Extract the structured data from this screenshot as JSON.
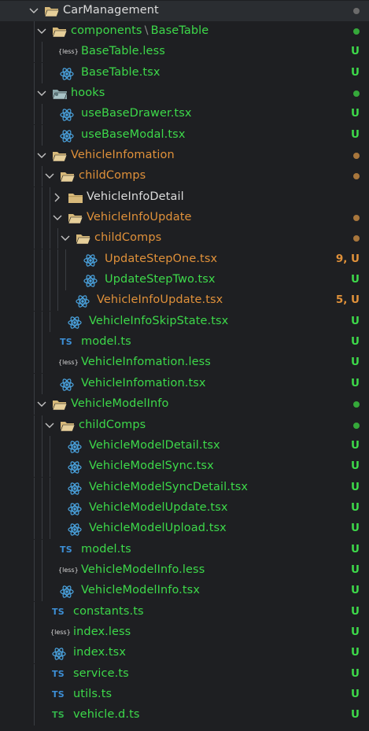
{
  "colors": {
    "green": "#3dd94a",
    "orange": "#e0913a",
    "white": "#dcdcdc",
    "dotGreen": "#35a83a",
    "dotOrange": "#a8763c",
    "react": "#4aa3df"
  },
  "rows": [
    {
      "id": "car-management",
      "label": "CarManagement",
      "depth": 0,
      "kind": "folder",
      "open": true,
      "color": "white",
      "badge": "dot",
      "badgeColor": "#6b6b6b",
      "selected": true
    },
    {
      "id": "components-basetable",
      "label": "components",
      "label2": "BaseTable",
      "depth": 1,
      "kind": "folder",
      "open": true,
      "color": "green",
      "badge": "dot",
      "badgeColor": "green"
    },
    {
      "id": "basetable-less",
      "label": "BaseTable.less",
      "depth": 2,
      "kind": "less",
      "color": "green",
      "badge": "U"
    },
    {
      "id": "basetable-tsx",
      "label": "BaseTable.tsx",
      "depth": 2,
      "kind": "react",
      "color": "green",
      "badge": "U"
    },
    {
      "id": "hooks",
      "label": "hooks",
      "depth": 1,
      "kind": "folder-special",
      "open": true,
      "color": "green",
      "badge": "dot",
      "badgeColor": "green"
    },
    {
      "id": "use-base-drawer",
      "label": "useBaseDrawer.tsx",
      "depth": 2,
      "kind": "react",
      "color": "green",
      "badge": "U"
    },
    {
      "id": "use-base-modal",
      "label": "useBaseModal.tsx",
      "depth": 2,
      "kind": "react",
      "color": "green",
      "badge": "U"
    },
    {
      "id": "vehicle-infomation",
      "label": "VehicleInfomation",
      "depth": 1,
      "kind": "folder",
      "open": true,
      "color": "orange",
      "badge": "dot",
      "badgeColor": "orange"
    },
    {
      "id": "child-comps-1",
      "label": "childComps",
      "depth": 2,
      "kind": "folder",
      "open": true,
      "color": "orange",
      "badge": "dot",
      "badgeColor": "orange"
    },
    {
      "id": "vehicle-info-detail",
      "label": "VehicleInfoDetail",
      "depth": 3,
      "kind": "folder",
      "open": false,
      "color": "white",
      "badge": ""
    },
    {
      "id": "vehicle-info-update-folder",
      "label": "VehicleInfoUpdate",
      "depth": 3,
      "kind": "folder",
      "open": true,
      "color": "orange",
      "badge": "dot",
      "badgeColor": "orange"
    },
    {
      "id": "child-comps-2",
      "label": "childComps",
      "depth": 4,
      "kind": "folder",
      "open": true,
      "color": "orange",
      "badge": "dot",
      "badgeColor": "orange"
    },
    {
      "id": "update-step-one",
      "label": "UpdateStepOne.tsx",
      "depth": 5,
      "kind": "react",
      "color": "orange",
      "badge": "9, U"
    },
    {
      "id": "update-step-two",
      "label": "UpdateStepTwo.tsx",
      "depth": 5,
      "kind": "react",
      "color": "green",
      "badge": "U"
    },
    {
      "id": "vehicle-info-update-tsx",
      "label": "VehicleInfoUpdate.tsx",
      "depth": 4,
      "kind": "react",
      "color": "orange",
      "badge": "5, U"
    },
    {
      "id": "vehicle-info-skip-state",
      "label": "VehicleInfoSkipState.tsx",
      "depth": 3,
      "kind": "react",
      "color": "green",
      "badge": "U"
    },
    {
      "id": "model-ts-1",
      "label": "model.ts",
      "depth": 2,
      "kind": "ts",
      "color": "green",
      "badge": "U"
    },
    {
      "id": "vehicle-infomation-less",
      "label": "VehicleInfomation.less",
      "depth": 2,
      "kind": "less",
      "color": "green",
      "badge": "U"
    },
    {
      "id": "vehicle-infomation-tsx",
      "label": "VehicleInfomation.tsx",
      "depth": 2,
      "kind": "react",
      "color": "green",
      "badge": "U"
    },
    {
      "id": "vehicle-model-info",
      "label": "VehicleModelInfo",
      "depth": 1,
      "kind": "folder",
      "open": true,
      "color": "green",
      "badge": "dot",
      "badgeColor": "green"
    },
    {
      "id": "child-comps-3",
      "label": "childComps",
      "depth": 2,
      "kind": "folder",
      "open": true,
      "color": "green",
      "badge": "dot",
      "badgeColor": "green"
    },
    {
      "id": "vehicle-model-detail",
      "label": "VehicleModelDetail.tsx",
      "depth": 3,
      "kind": "react",
      "color": "green",
      "badge": "U"
    },
    {
      "id": "vehicle-model-sync",
      "label": "VehicleModelSync.tsx",
      "depth": 3,
      "kind": "react",
      "color": "green",
      "badge": "U"
    },
    {
      "id": "vehicle-model-sync-detail",
      "label": "VehicleModelSyncDetail.tsx",
      "depth": 3,
      "kind": "react",
      "color": "green",
      "badge": "U"
    },
    {
      "id": "vehicle-model-update",
      "label": "VehicleModelUpdate.tsx",
      "depth": 3,
      "kind": "react",
      "color": "green",
      "badge": "U"
    },
    {
      "id": "vehicle-model-upload",
      "label": "VehicleModelUpload.tsx",
      "depth": 3,
      "kind": "react",
      "color": "green",
      "badge": "U"
    },
    {
      "id": "model-ts-2",
      "label": "model.ts",
      "depth": 2,
      "kind": "ts",
      "color": "green",
      "badge": "U"
    },
    {
      "id": "vehicle-model-info-less",
      "label": "VehicleModelInfo.less",
      "depth": 2,
      "kind": "less",
      "color": "green",
      "badge": "U"
    },
    {
      "id": "vehicle-model-info-tsx",
      "label": "VehicleModelInfo.tsx",
      "depth": 2,
      "kind": "react",
      "color": "green",
      "badge": "U"
    },
    {
      "id": "constants-ts",
      "label": "constants.ts",
      "depth": 1,
      "kind": "ts",
      "color": "green",
      "badge": "U"
    },
    {
      "id": "index-less",
      "label": "index.less",
      "depth": 1,
      "kind": "less",
      "color": "green",
      "badge": "U"
    },
    {
      "id": "index-tsx",
      "label": "index.tsx",
      "depth": 1,
      "kind": "react",
      "color": "green",
      "badge": "U"
    },
    {
      "id": "service-ts",
      "label": "service.ts",
      "depth": 1,
      "kind": "ts",
      "color": "green",
      "badge": "U"
    },
    {
      "id": "utils-ts",
      "label": "utils.ts",
      "depth": 1,
      "kind": "ts",
      "color": "green",
      "badge": "U"
    },
    {
      "id": "vehicle-d-ts",
      "label": "vehicle.d.ts",
      "depth": 1,
      "kind": "ts-green",
      "color": "green",
      "badge": "U"
    }
  ],
  "icons": {
    "ts_text": "TS",
    "less_text": "less",
    "path_separator": "\\"
  }
}
